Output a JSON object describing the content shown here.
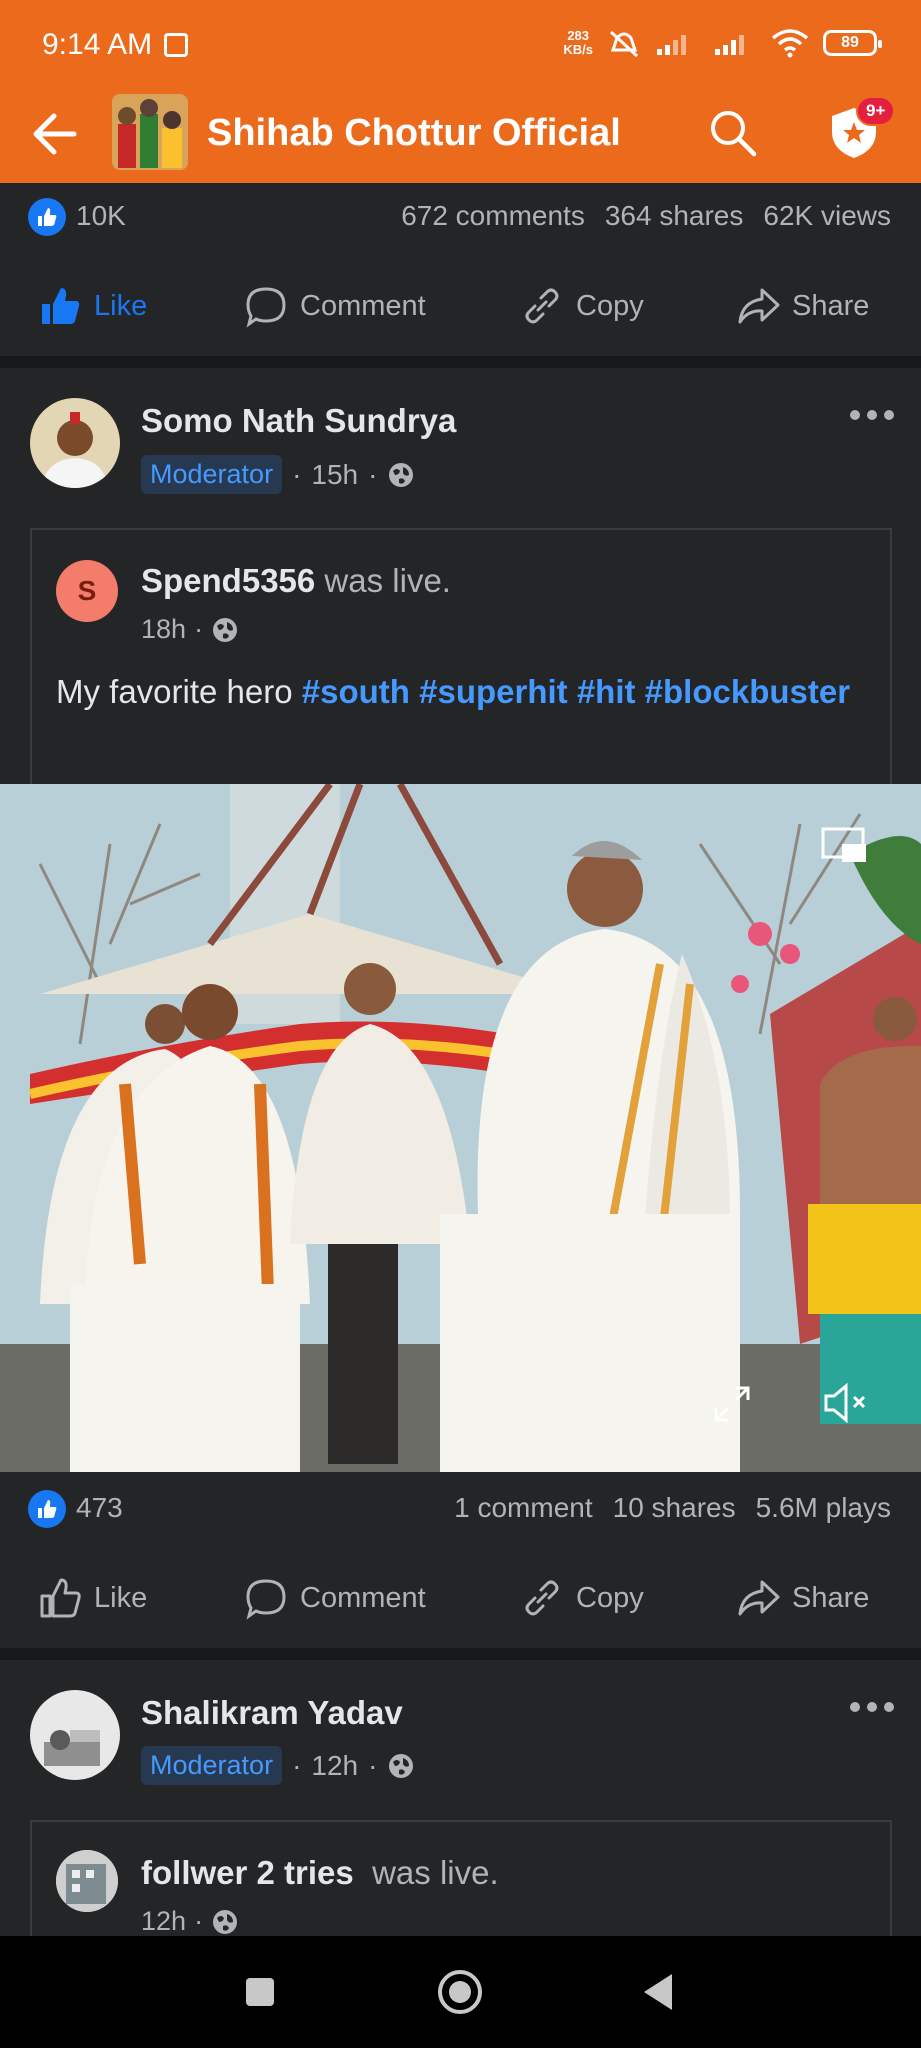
{
  "status": {
    "time": "9:14 AM",
    "net_speed_value": "283",
    "net_speed_unit": "KB/s",
    "battery": "89"
  },
  "appbar": {
    "title": "Shihab Chottur Official",
    "notification_count": "9+"
  },
  "prev_post": {
    "likes": "10K",
    "comments": "672 comments",
    "shares": "364 shares",
    "views": "62K views",
    "actions": {
      "like": "Like",
      "comment": "Comment",
      "copy": "Copy",
      "share": "Share"
    }
  },
  "post1": {
    "author": "Somo Nath Sundrya",
    "role": "Moderator",
    "time": "15h",
    "shared": {
      "name": "Spend5356",
      "suffix": "was live.",
      "avatar_letter": "S",
      "time": "18h"
    },
    "caption_text": "My favorite hero ",
    "tags": [
      "#south",
      "#superhit",
      "#hit",
      "#blockbuster"
    ],
    "likes": "473",
    "comments": "1 comment",
    "shares": "10 shares",
    "plays": "5.6M plays",
    "actions": {
      "like": "Like",
      "comment": "Comment",
      "copy": "Copy",
      "share": "Share"
    }
  },
  "post2": {
    "author": "Shalikram Yadav",
    "role": "Moderator",
    "time": "12h",
    "shared": {
      "name": "follwer 2 tries",
      "suffix": "was live.",
      "time": "12h"
    }
  },
  "colors": {
    "brand": "#ec6a1c",
    "fb_blue": "#1877f2",
    "link_blue": "#4599ff",
    "bg": "#242526"
  }
}
